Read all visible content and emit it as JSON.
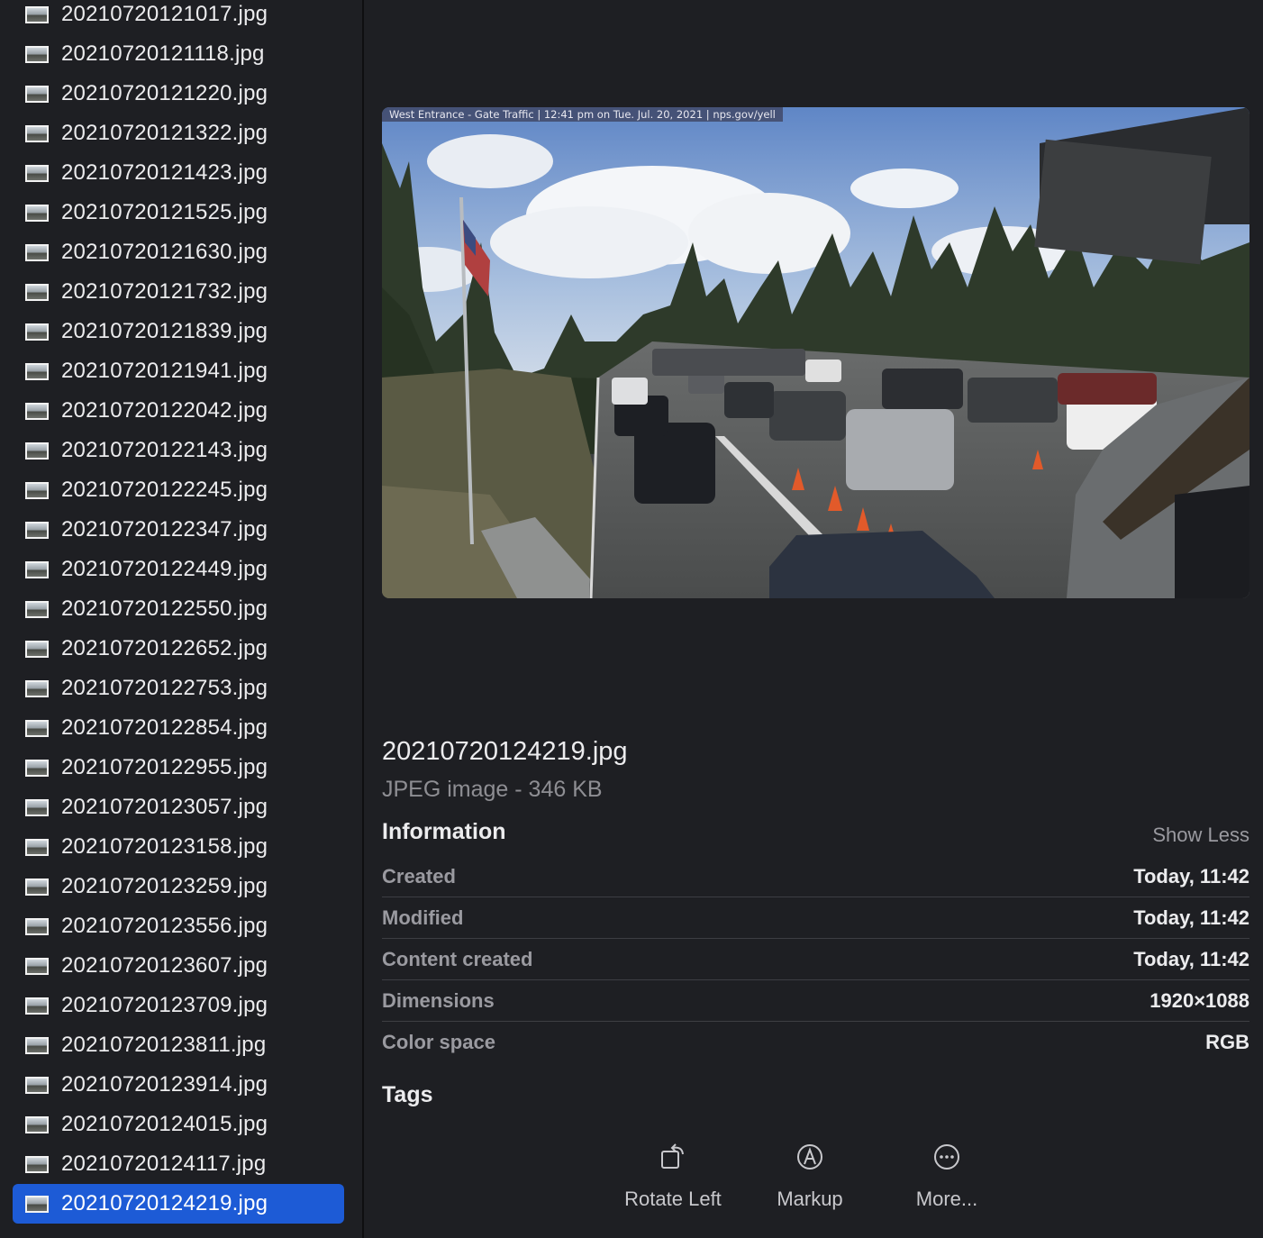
{
  "file_list": {
    "items": [
      "20210720121017.jpg",
      "20210720121118.jpg",
      "20210720121220.jpg",
      "20210720121322.jpg",
      "20210720121423.jpg",
      "20210720121525.jpg",
      "20210720121630.jpg",
      "20210720121732.jpg",
      "20210720121839.jpg",
      "20210720121941.jpg",
      "20210720122042.jpg",
      "20210720122143.jpg",
      "20210720122245.jpg",
      "20210720122347.jpg",
      "20210720122449.jpg",
      "20210720122550.jpg",
      "20210720122652.jpg",
      "20210720122753.jpg",
      "20210720122854.jpg",
      "20210720122955.jpg",
      "20210720123057.jpg",
      "20210720123158.jpg",
      "20210720123259.jpg",
      "20210720123556.jpg",
      "20210720123607.jpg",
      "20210720123709.jpg",
      "20210720123811.jpg",
      "20210720123914.jpg",
      "20210720124015.jpg",
      "20210720124117.jpg",
      "20210720124219.jpg"
    ],
    "selected_index": 30,
    "item_icon": "image-file-icon",
    "selection_color": "#1d5bd6"
  },
  "preview": {
    "image_caption": "West Entrance - Gate Traffic  | 12:41 pm on Tue. Jul. 20, 2021  |  nps.gov/yell",
    "file_name": "20210720124219.jpg",
    "file_kind": "JPEG image - 346 KB"
  },
  "information": {
    "heading": "Information",
    "toggle_label": "Show Less",
    "rows": [
      {
        "label": "Created",
        "value": "Today, 11:42"
      },
      {
        "label": "Modified",
        "value": "Today, 11:42"
      },
      {
        "label": "Content created",
        "value": "Today, 11:42"
      },
      {
        "label": "Dimensions",
        "value": "1920×1088"
      },
      {
        "label": "Color space",
        "value": "RGB"
      }
    ]
  },
  "tags": {
    "heading": "Tags"
  },
  "actions": {
    "rotate_left": {
      "label": "Rotate Left",
      "icon": "rotate-left-icon"
    },
    "markup": {
      "label": "Markup",
      "icon": "markup-pen-icon"
    },
    "more": {
      "label": "More...",
      "icon": "more-ellipsis-icon"
    }
  }
}
